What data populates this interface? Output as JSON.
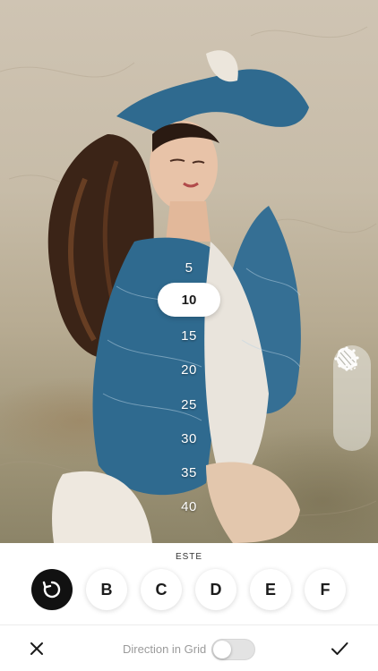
{
  "picker": {
    "values": [
      "5",
      "10",
      "15",
      "20",
      "25",
      "30",
      "35",
      "40"
    ],
    "selected": "10"
  },
  "side_tools": [
    {
      "icon": "circular-dots-c-icon"
    },
    {
      "icon": "brush-hand-icon"
    }
  ],
  "style_strip": {
    "current_name": "ESTE",
    "reset_icon": "rotate-icon",
    "options": [
      "B",
      "C",
      "D",
      "E",
      "F"
    ]
  },
  "bottom_bar": {
    "close_icon": "close-icon",
    "toggle_label": "Direction in Grid",
    "toggle_on": false,
    "confirm_icon": "checkmark-icon"
  },
  "colors": {
    "selected_bg": "#ffffff",
    "reset_bg": "#111111",
    "jacket": "#2f6a8f"
  }
}
